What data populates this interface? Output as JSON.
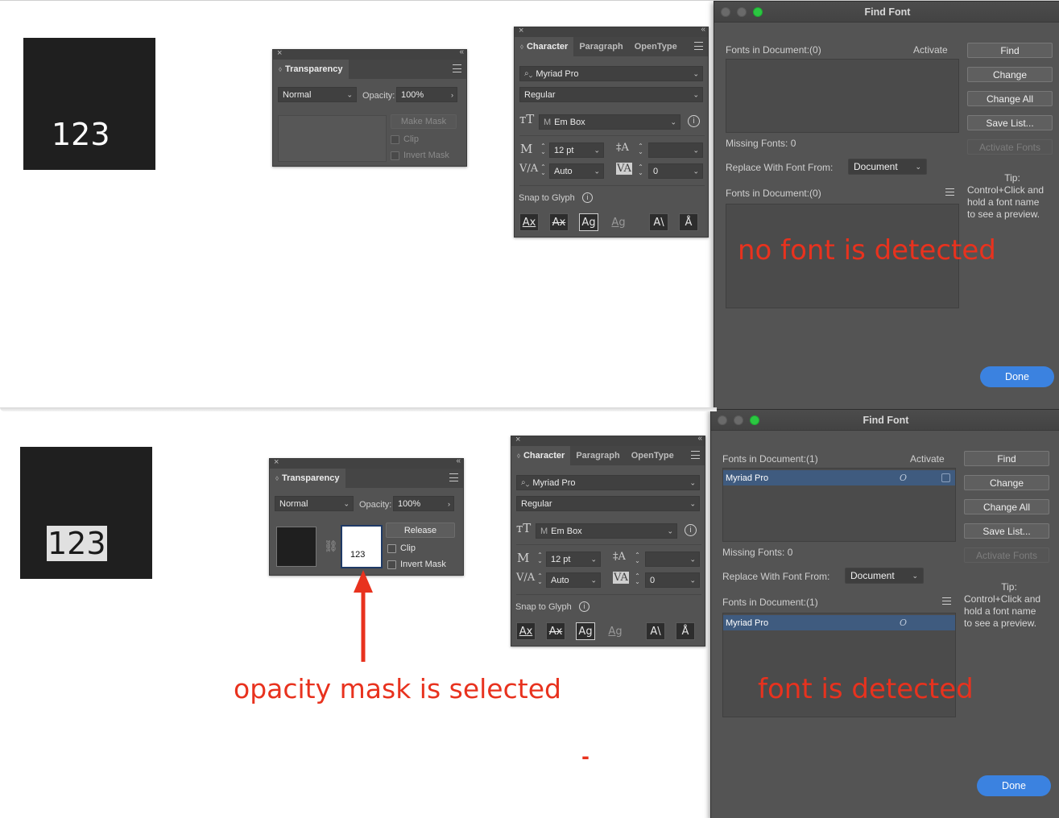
{
  "top": {
    "art_text": "123",
    "transparency": {
      "tab": "Transparency",
      "blend_mode": "Normal",
      "opacity_label": "Opacity:",
      "opacity_value": "100%",
      "make_mask": "Make Mask",
      "clip": "Clip",
      "invert_mask": "Invert Mask"
    },
    "character": {
      "tabs": [
        "Character",
        "Paragraph",
        "OpenType"
      ],
      "font_search": "Myriad Pro",
      "font_style": "Regular",
      "em_box": "Em Box",
      "font_size": "12 pt",
      "leading": "",
      "kerning": "Auto",
      "tracking": "0",
      "snap_label": "Snap to Glyph"
    },
    "find_font": {
      "title": "Find Font",
      "fonts_in_doc_label": "Fonts in Document:(0)",
      "activate_label": "Activate",
      "missing_fonts": "Missing Fonts: 0",
      "replace_label": "Replace With Font From:",
      "replace_value": "Document",
      "fonts_in_doc_label2": "Fonts in Document:(0)",
      "buttons": [
        "Find",
        "Change",
        "Change All",
        "Save List..."
      ],
      "activate_fonts": "Activate Fonts",
      "tip_title": "Tip:",
      "tip_lines": [
        "Control+Click and",
        "hold a font name",
        "to see a preview."
      ],
      "done": "Done",
      "annotation": "no font is detected"
    }
  },
  "bottom": {
    "art_text": "123",
    "transparency": {
      "tab": "Transparency",
      "blend_mode": "Normal",
      "opacity_label": "Opacity:",
      "opacity_value": "100%",
      "release": "Release",
      "clip": "Clip",
      "invert_mask": "Invert Mask",
      "mask_thumb_text": "123"
    },
    "character": {
      "tabs": [
        "Character",
        "Paragraph",
        "OpenType"
      ],
      "font_search": "Myriad Pro",
      "font_style": "Regular",
      "em_box": "Em Box",
      "font_size": "12 pt",
      "leading": "",
      "kerning": "Auto",
      "tracking": "0",
      "snap_label": "Snap to Glyph"
    },
    "find_font": {
      "title": "Find Font",
      "fonts_in_doc_label": "Fonts in Document:(1)",
      "activate_label": "Activate",
      "font_row": "Myriad Pro",
      "missing_fonts": "Missing Fonts: 0",
      "replace_label": "Replace With Font From:",
      "replace_value": "Document",
      "fonts_in_doc_label2": "Fonts in Document:(1)",
      "font_row2": "Myriad Pro",
      "buttons": [
        "Find",
        "Change",
        "Change All",
        "Save List..."
      ],
      "activate_fonts": "Activate Fonts",
      "tip_title": "Tip:",
      "tip_lines": [
        "Control+Click and",
        "hold a font name",
        "to see a preview."
      ],
      "done": "Done",
      "annotation": "font is detected"
    },
    "annotation_mask": "opacity mask is selected",
    "stray_mark": "-"
  },
  "colors": {
    "annotation": "#e8321e",
    "done_button": "#3b82e0",
    "selected_row": "#3f5b7f"
  }
}
